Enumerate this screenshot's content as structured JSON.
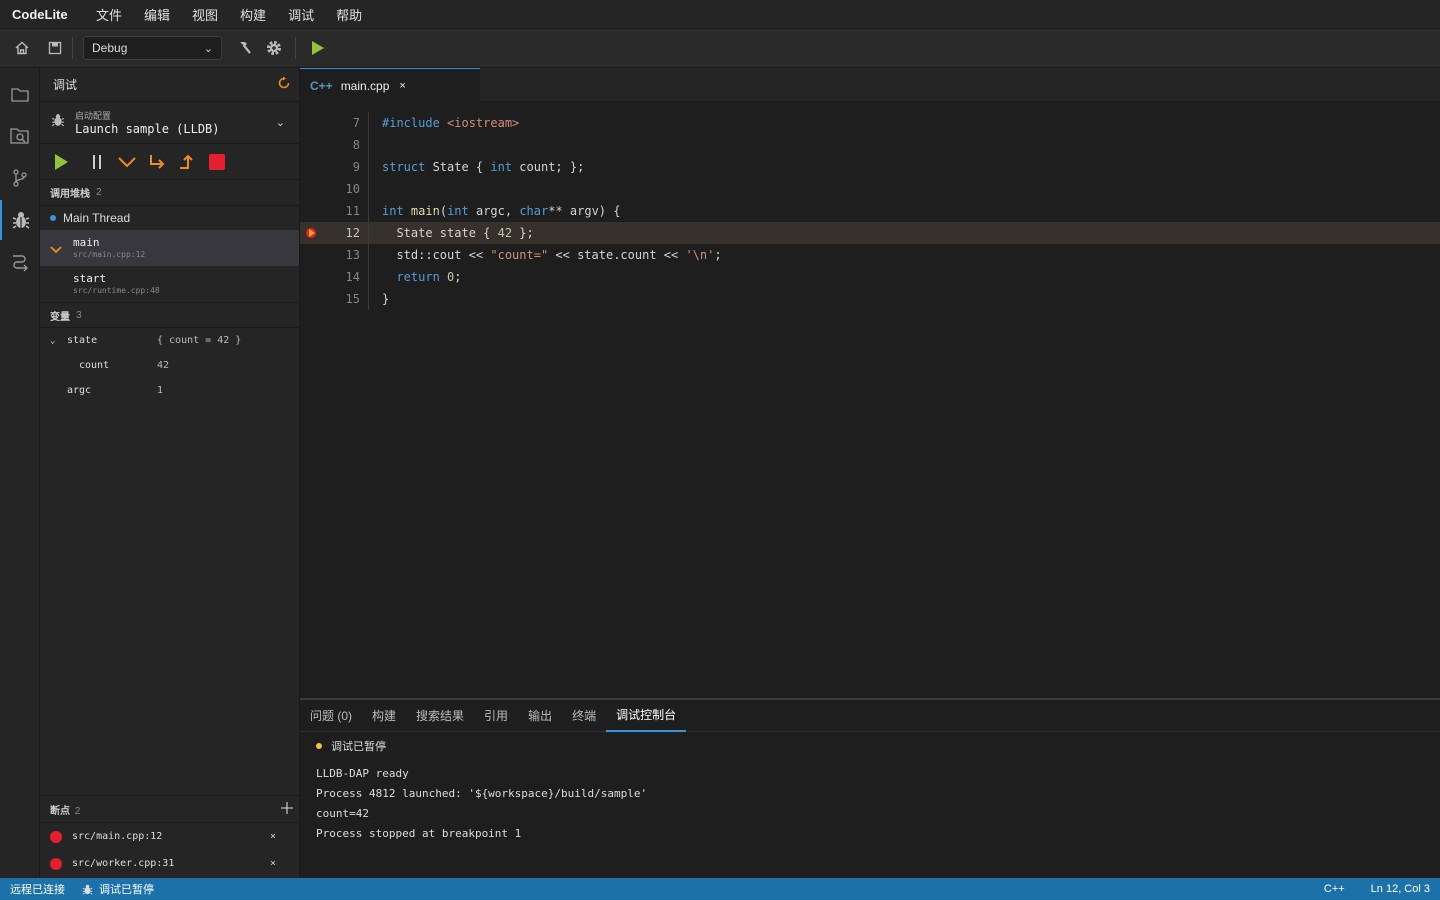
{
  "menubar": {
    "brand": "CodeLite",
    "items": [
      "文件",
      "编辑",
      "视图",
      "构建",
      "调试",
      "帮助"
    ]
  },
  "toolbar": {
    "config": "Debug",
    "icons": [
      "home-icon",
      "save-icon",
      "hammer-icon",
      "gear-icon",
      "play-icon"
    ]
  },
  "activity": [
    "folder-icon",
    "search-icon",
    "git-branch-icon",
    "bug-icon",
    "remote-icon"
  ],
  "debug_panel": {
    "title": "调试",
    "launch_sub": "启动配置",
    "launch_name": "Launch sample (LLDB)",
    "callstack_title": "调用堆栈",
    "callstack_count": "2",
    "thread": "Main Thread",
    "frames": [
      {
        "fn": "main",
        "loc": "src/main.cpp:12"
      },
      {
        "fn": "start",
        "loc": "src/runtime.cpp:48"
      }
    ],
    "variables_title": "变量",
    "variables_count": "3",
    "variables": [
      {
        "name": "state",
        "value": "{ count = 42 }"
      },
      {
        "name": "count",
        "value": "42"
      },
      {
        "name": "argc",
        "value": "1"
      }
    ],
    "breakpoints_title": "断点",
    "breakpoints_count": "2",
    "breakpoints": [
      "src/main.cpp:12",
      "src/worker.cpp:31"
    ]
  },
  "editor": {
    "tab_lang": "C++",
    "tab_name": "main.cpp",
    "line_numbers": [
      "7",
      "8",
      "9",
      "10",
      "11",
      "12",
      "13",
      "14",
      "15"
    ],
    "current_line": "12"
  },
  "bottom": {
    "tabs": [
      "问题 (0)",
      "构建",
      "搜索结果",
      "引用",
      "输出",
      "终端",
      "调试控制台"
    ],
    "status": "调试已暂停",
    "console": [
      "LLDB-DAP ready",
      "Process 4812 launched: '${workspace}/build/sample'",
      "count=42",
      "Process stopped at breakpoint 1"
    ]
  },
  "statusbar": {
    "left1": "远程已连接",
    "left2": "调试已暂停",
    "lang": "C++",
    "pos": "Ln 12, Col 3"
  },
  "colors": {
    "accent": "#3794d8",
    "status_bg": "#1c71a8",
    "breakpoint": "#e51f2e",
    "current_line": "#36312a"
  }
}
